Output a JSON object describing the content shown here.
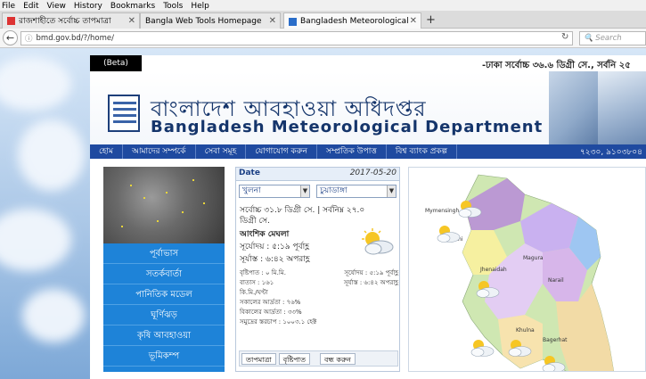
{
  "menubar": [
    "File",
    "Edit",
    "View",
    "History",
    "Bookmarks",
    "Tools",
    "Help"
  ],
  "tabs": [
    {
      "label": "রাজশাহীতে সর্বোচ্চ তাপমাত্রা",
      "active": false
    },
    {
      "label": "Bangla Web Tools Homepage",
      "active": false
    },
    {
      "label": "Bangladesh Meteorological",
      "active": true
    }
  ],
  "url": "bmd.gov.bd/?/home/",
  "search_placeholder": "Search",
  "site": {
    "beta": "(Beta)",
    "marquee": "-ঢাকা সর্বোচ্চ ৩৬.৬ ডিগ্রী সে., সর্বনি ২৫",
    "title_bn": "বাংলাদেশ আবহাওয়া অধিদপ্তর",
    "title_en": "Bangladesh Meteorological Department",
    "nav": [
      "হোম",
      "আমাদের সম্পর্কে",
      "সেবা সমূহ",
      "যোগাযোগ করুন",
      "সম্প্রতিক উপাত্ত",
      "বিশ্ব ব্যাংক প্রকল্প"
    ],
    "nav_date": "৭২৩০, ৯১০৩৮০৪"
  },
  "left_menu": [
    "পূর্বাভাস",
    "সতর্কবার্তা",
    "পানিতিক মডেল",
    "ঘূর্ণিঝড়",
    "কৃষি আবহাওয়া",
    "ভূমিকম্প"
  ],
  "forecast": {
    "date_label": "Date",
    "date_value": "2017-05-20",
    "division": "খুলনা",
    "district": "চুয়াডাঙ্গা",
    "temp_line1": "সর্বোচ্চ ৩১.৮ ডিগ্রী সে. | সর্বনিম্ন ২৭.০",
    "temp_line2": "ডিগ্রী সে.",
    "condition": "আংশিক মেঘলা",
    "sunrise": "সূর্যোদয় : ৫:১৯ পূর্বাহ্ণ",
    "sunset": "সূর্যাস্ত : ৬:৪২ অপরাহ্ণ",
    "details": [
      [
        "বৃষ্টিপাত : ০ মি.মি.",
        "সূর্যোদয় : ৫:১৯ পূর্বাহ্ণ"
      ],
      [
        "বাতাস : ১৬১",
        "সূর্যাস্ত : ৬:৪২ অপরাহ্ণ"
      ],
      [
        "কি.মি./ঘণ্টা",
        ""
      ],
      [
        "সকালের আর্দ্রতা : ৭৬%",
        ""
      ],
      [
        "বিকালের আর্দ্রতা : ৩৩%",
        ""
      ],
      [
        "সমুদ্রের স্তরচাপ : ১০০৩.১ হেক্ট",
        ""
      ]
    ],
    "tabs": [
      "তাপমাত্রা",
      "বৃষ্টিপাত",
      "বন্ধ করুন"
    ]
  },
  "map_labels": [
    "Mymensingh",
    "Rajshahi",
    "Jhenaidah",
    "Magura",
    "Narail",
    "Khulna",
    "Bagerhat"
  ],
  "colors": {
    "accent": "#1f4aa0",
    "menu": "#1e83d8",
    "brand": "#15356b"
  }
}
